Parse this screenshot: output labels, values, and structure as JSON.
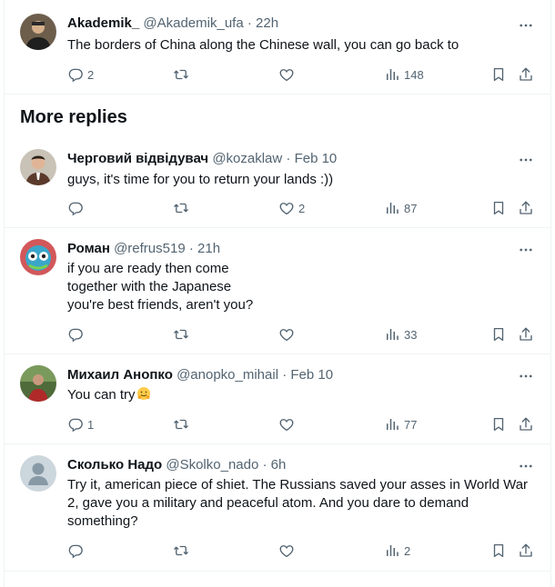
{
  "section_title": "More replies",
  "tweets": [
    {
      "name": "Akademik_",
      "handle": "@Akademik_ufa",
      "time": "22h",
      "lines": [
        "The borders of China along the Chinese wall, you can go back to"
      ],
      "replies": "2",
      "retweets": "",
      "likes": "",
      "views": "148"
    },
    {
      "name": "Черговий відвідувач",
      "handle": "@kozaklaw",
      "time": "Feb 10",
      "lines": [
        "guys, it's time for you to return your lands :))"
      ],
      "replies": "",
      "retweets": "",
      "likes": "2",
      "views": "87"
    },
    {
      "name": "Роман",
      "handle": "@refrus519",
      "time": "21h",
      "lines": [
        "if you are ready then come",
        "together with the Japanese",
        "you're best friends, aren't you?"
      ],
      "replies": "",
      "retweets": "",
      "likes": "",
      "views": "33"
    },
    {
      "name": "Михаил Анопко",
      "handle": "@anopko_mihail",
      "time": "Feb 10",
      "lines": [
        "You can try"
      ],
      "replies": "1",
      "retweets": "",
      "likes": "",
      "views": "77"
    },
    {
      "name": "Сколько Надо",
      "handle": "@Skolko_nado",
      "time": "6h",
      "text": "Try it, american piece of shiet. The Russians saved your asses in World War 2, gave you a military and peaceful atom. And you dare to demand something?",
      "replies": "",
      "retweets": "",
      "likes": "",
      "views": "2"
    }
  ],
  "colors": {
    "text": "#0f1419",
    "secondary": "#536471",
    "border": "#eff3f4"
  },
  "icons": [
    "reply-icon",
    "retweet-icon",
    "like-icon",
    "views-icon",
    "bookmark-icon",
    "share-icon",
    "more-icon",
    "hugging-emoji"
  ]
}
